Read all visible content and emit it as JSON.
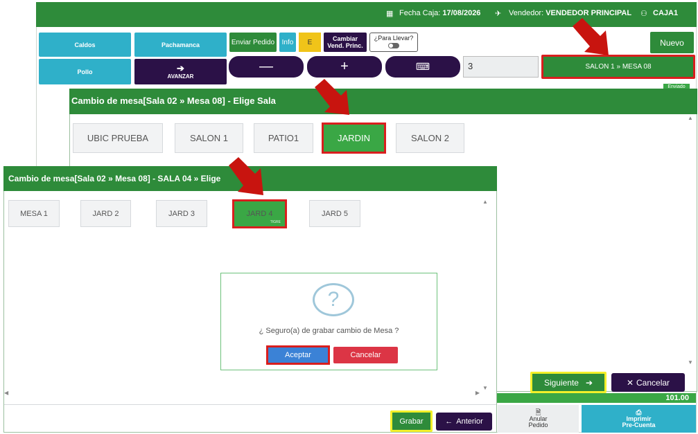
{
  "topbar": {
    "fecha_label": "Fecha Caja:",
    "fecha_value": "17/08/2026",
    "vendedor_label": "Vendedor:",
    "vendedor_value": "VENDEDOR PRINCIPAL",
    "caja": "CAJA1"
  },
  "categories": [
    "Caldos",
    "Pachamanca",
    "Pollo"
  ],
  "avanzar_label": "AVANZAR",
  "toolbar": {
    "enviar_pedido": "Enviar Pedido",
    "info": "Info",
    "e": "E",
    "cambiar_line1": "Cambiar",
    "cambiar_line2": "Vend. Princ.",
    "para_llevar": "¿Para Llevar?",
    "nuevo": "Nuevo",
    "minus": "—",
    "plus": "+",
    "quantity": "3",
    "mesa_button": "SALON 1 » MESA 08"
  },
  "enviado_badge": "Enviado",
  "modal_sala": {
    "title": "Cambio de mesa[Sala 02 » Mesa 08] - Elige Sala",
    "salas": [
      "UBIC PRUEBA",
      "SALON 1",
      "PATIO1",
      "JARDIN",
      "SALON 2"
    ],
    "selected": "JARDIN",
    "siguiente": "Siguiente",
    "cancelar": "Cancelar"
  },
  "modal_mesa": {
    "title": "Cambio de mesa[Sala 02 » Mesa 08] - SALA 04 » Elige",
    "mesas": [
      "MESA 1",
      "JARD 2",
      "JARD 3",
      "JARD 4",
      "JARD 5"
    ],
    "selected_tag": "TIGRE",
    "grabar": "Grabar",
    "anterior": "Anterior"
  },
  "confirm": {
    "icon_glyph": "?",
    "question": "¿ Seguro(a) de grabar cambio de Mesa ?",
    "aceptar": "Aceptar",
    "cancelar": "Cancelar"
  },
  "footer": {
    "total": "101.00",
    "anular_line1": "Anular",
    "anular_line2": "Pedido",
    "imprimir_line1": "Imprimir",
    "imprimir_line2": "Pre-Cuenta"
  },
  "colors": {
    "brand_green": "#2e8b3a",
    "teal": "#2fb0c9",
    "dark_purple": "#2b1147",
    "highlight_red": "#d91e1e",
    "highlight_yellow": "#f3f02a",
    "arrow_red": "#c8140f"
  }
}
